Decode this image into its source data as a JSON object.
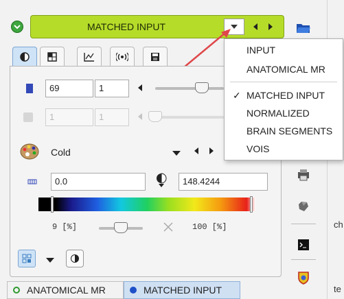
{
  "header": {
    "title": "MATCHED INPUT"
  },
  "tabs": [
    {
      "icon": "contrast-icon"
    },
    {
      "icon": "layout-grid-icon"
    },
    {
      "icon": "chart-icon"
    },
    {
      "icon": "broadcast-icon"
    },
    {
      "icon": "save-disk-icon"
    }
  ],
  "frame_row": {
    "field1": "69",
    "field2": "1",
    "slider_level": 0.6
  },
  "frame_row_disabled": {
    "field1": "1",
    "field2": "1"
  },
  "colormap": {
    "name": "Cold"
  },
  "range": {
    "min": "0.0",
    "max": "148.4244"
  },
  "percent": {
    "lower": "9 [%]",
    "upper": "100 [%]",
    "slider_level": 0.2
  },
  "dropdown": {
    "items": [
      {
        "label": "INPUT",
        "checked": false
      },
      {
        "label": "ANATOMICAL MR",
        "checked": false
      },
      {
        "label": "MATCHED INPUT",
        "checked": true
      },
      {
        "label": "NORMALIZED",
        "checked": false
      },
      {
        "label": "BRAIN SEGMENTS",
        "checked": false
      },
      {
        "label": "VOIS",
        "checked": false
      }
    ],
    "check_mark": "✓"
  },
  "bottom_tabs": [
    {
      "label": "ANATOMICAL MR",
      "dot_color": "#2e9a2e"
    },
    {
      "label": "MATCHED INPUT",
      "dot_color": "#1e50c8"
    }
  ],
  "side_text": {
    "ch": "ch",
    "te": "te"
  },
  "colors": {
    "accent_green": "#b6dc2a",
    "arrow_red": "#e0474a"
  }
}
